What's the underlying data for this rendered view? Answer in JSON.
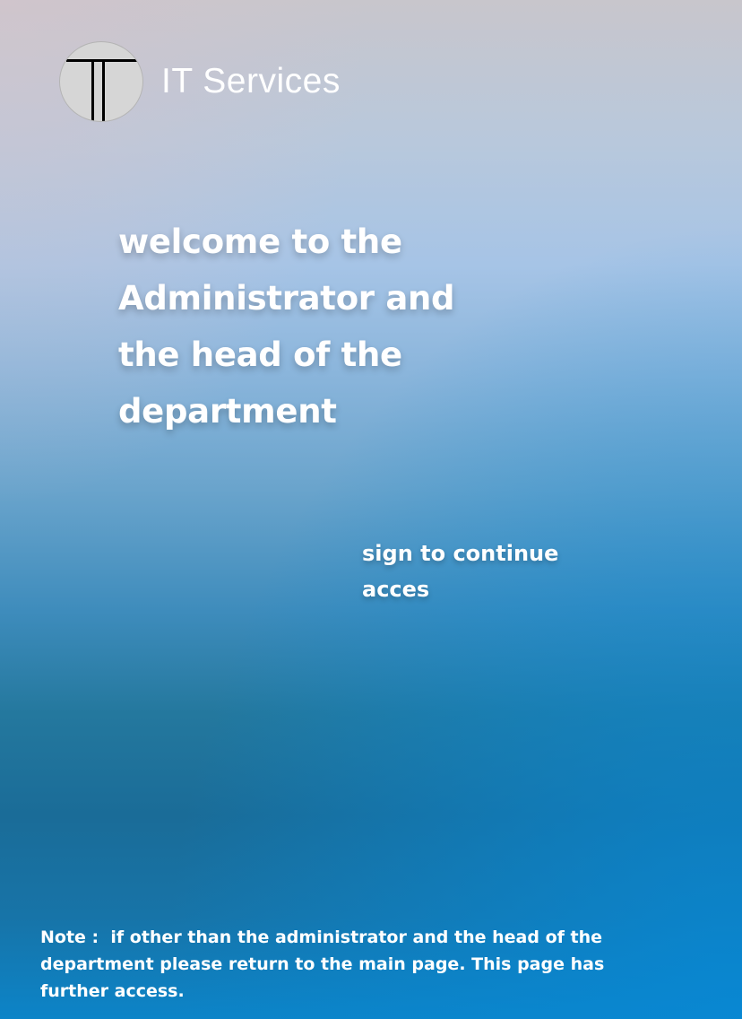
{
  "header": {
    "brand_name": "IT Services",
    "logo_icon": "letter-t-logo-icon"
  },
  "main": {
    "welcome_heading": "welcome to the Administrator and the head of the department",
    "signin_prompt": "sign to continue acces"
  },
  "footer": {
    "note_label": "Note :  ",
    "note_text": "if other than the administrator and the head of the department please return to the main page. This page has further access."
  },
  "colors": {
    "background_top": "#c8c6cc",
    "background_mid": "#a6c4e6",
    "background_bottom": "#0c84c8",
    "logo_fill": "#d6d6d6",
    "text": "#ffffff"
  }
}
